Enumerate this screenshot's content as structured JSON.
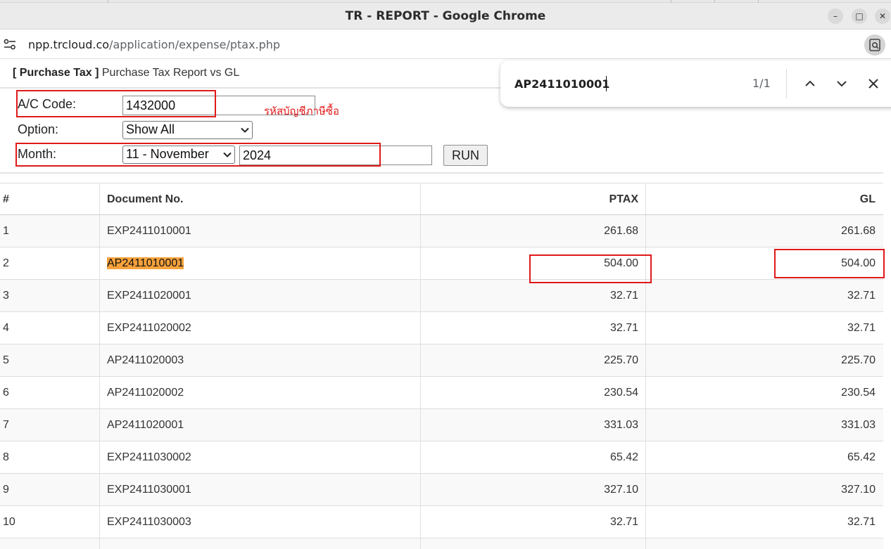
{
  "window": {
    "title": "TR - REPORT - Google Chrome",
    "minimize_glyph": "–",
    "maximize_glyph": "□",
    "close_glyph": "✕"
  },
  "address": {
    "host": "npp.trcloud.co",
    "path": "/application/expense/ptax.php"
  },
  "header": {
    "module": "[ Purchase Tax ]",
    "title": "Purchase Tax Report vs GL"
  },
  "form": {
    "ac_code_label": "A/C Code:",
    "ac_code_value": "1432000",
    "ac_code_note": "รหัสบัญชีภาษีซื้อ",
    "option_label": "Option:",
    "option_selected": "Show All",
    "month_label": "Month:",
    "month_selected": "11 - November",
    "year_value": "2024",
    "run_label": "RUN"
  },
  "table": {
    "columns": [
      "#",
      "Document No.",
      "PTAX",
      "GL"
    ],
    "rows": [
      {
        "num": "1",
        "doc": "EXP2411010001",
        "ptax": "261.68",
        "gl": "261.68"
      },
      {
        "num": "2",
        "doc": "AP2411010001",
        "ptax": "504.00",
        "gl": "504.00"
      },
      {
        "num": "3",
        "doc": "EXP2411020001",
        "ptax": "32.71",
        "gl": "32.71"
      },
      {
        "num": "4",
        "doc": "EXP2411020002",
        "ptax": "32.71",
        "gl": "32.71"
      },
      {
        "num": "5",
        "doc": "AP2411020003",
        "ptax": "225.70",
        "gl": "225.70"
      },
      {
        "num": "6",
        "doc": "AP2411020002",
        "ptax": "230.54",
        "gl": "230.54"
      },
      {
        "num": "7",
        "doc": "AP2411020001",
        "ptax": "331.03",
        "gl": "331.03"
      },
      {
        "num": "8",
        "doc": "EXP2411030002",
        "ptax": "65.42",
        "gl": "65.42"
      },
      {
        "num": "9",
        "doc": "EXP2411030001",
        "ptax": "327.10",
        "gl": "327.10"
      },
      {
        "num": "10",
        "doc": "EXP2411030003",
        "ptax": "32.71",
        "gl": "32.71"
      }
    ]
  },
  "find": {
    "query": "AP2411010001",
    "count": "1/1"
  },
  "colors": {
    "annotation_red": "#e01919",
    "find_highlight": "#f7a23c"
  },
  "icons": {
    "site_info": "tune-icon",
    "lens": "google-lens-icon",
    "select_arrow": "chevron-down-icon",
    "find_prev": "chevron-up-icon",
    "find_next": "chevron-down-icon",
    "find_close": "close-icon"
  }
}
